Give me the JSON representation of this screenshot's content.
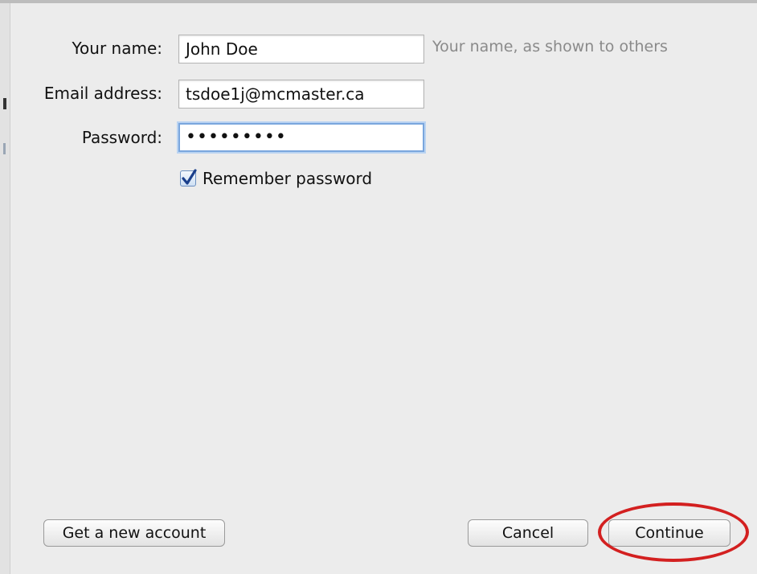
{
  "form": {
    "name_label": "Your name:",
    "name_value": "John Doe",
    "name_hint": "Your name, as shown to others",
    "email_label": "Email address:",
    "email_value": "tsdoe1j@mcmaster.ca",
    "password_label": "Password:",
    "password_value": "•••••••••",
    "remember_label": "Remember password",
    "remember_checked": true
  },
  "buttons": {
    "new_account": "Get a new account",
    "cancel": "Cancel",
    "continue": "Continue"
  },
  "colors": {
    "highlight": "#d32020",
    "focus": "#7aa6dd"
  },
  "icons": {
    "checkbox": "checkmark-icon"
  }
}
